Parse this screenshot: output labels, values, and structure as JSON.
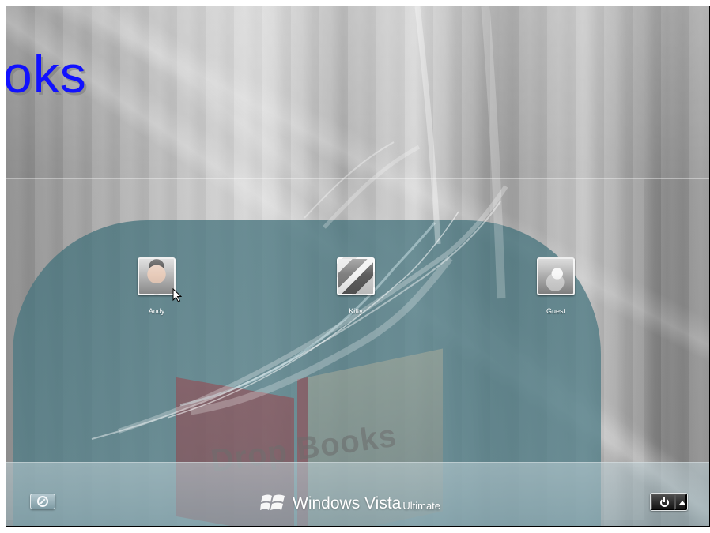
{
  "page": {
    "title_fragment": "oks"
  },
  "users": [
    {
      "name": "Andy"
    },
    {
      "name": "Kitty"
    },
    {
      "name": "Guest"
    }
  ],
  "branding": {
    "main": "Windows Vista",
    "sub": "Ultimate"
  },
  "watermark": {
    "text": "Drop Books"
  },
  "icons": {
    "ease_of_access": "ease-of-access-icon",
    "power": "power-icon",
    "menu": "chevron-up-icon",
    "logo": "windows-logo-icon",
    "cursor": "mouse-pointer-icon"
  }
}
